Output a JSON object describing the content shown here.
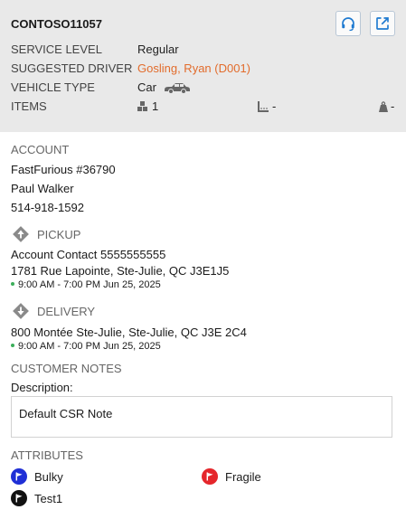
{
  "header": {
    "order_id": "CONTOSO11057",
    "service_level_label": "SERVICE LEVEL",
    "service_level_value": "Regular",
    "driver_label": "SUGGESTED DRIVER",
    "driver_value": "Gosling, Ryan (D001)",
    "vehicle_label": "VEHICLE TYPE",
    "vehicle_value": "Car",
    "items_label": "ITEMS",
    "items_count": "1",
    "items_dimension": "-",
    "items_weight": "-",
    "headset_icon": "headset-icon",
    "external_icon": "external-link-icon"
  },
  "account": {
    "title": "ACCOUNT",
    "name": "FastFurious #36790",
    "contact": "Paul Walker",
    "phone": "514-918-1592"
  },
  "pickup": {
    "title": "PICKUP",
    "contact": "Account Contact 5555555555",
    "address": "1781 Rue Lapointe, Ste-Julie, QC J3E1J5",
    "window": "9:00 AM - 7:00 PM Jun 25, 2025"
  },
  "delivery": {
    "title": "DELIVERY",
    "address": "800 Montée Ste-Julie, Ste-Julie, QC J3E 2C4",
    "window": "9:00 AM - 7:00 PM Jun 25, 2025"
  },
  "notes": {
    "title": "CUSTOMER NOTES",
    "description_label": "Description:",
    "text": "Default CSR Note"
  },
  "attributes": {
    "title": "ATTRIBUTES",
    "items": [
      {
        "label": "Bulky",
        "color": "#1f2fd6"
      },
      {
        "label": "Fragile",
        "color": "#e5262b"
      },
      {
        "label": "Test1",
        "color": "#111111"
      }
    ]
  },
  "colors": {
    "accent": "#1f7ad0",
    "driver": "#e26c2c",
    "time_dot": "#3cae5a"
  }
}
